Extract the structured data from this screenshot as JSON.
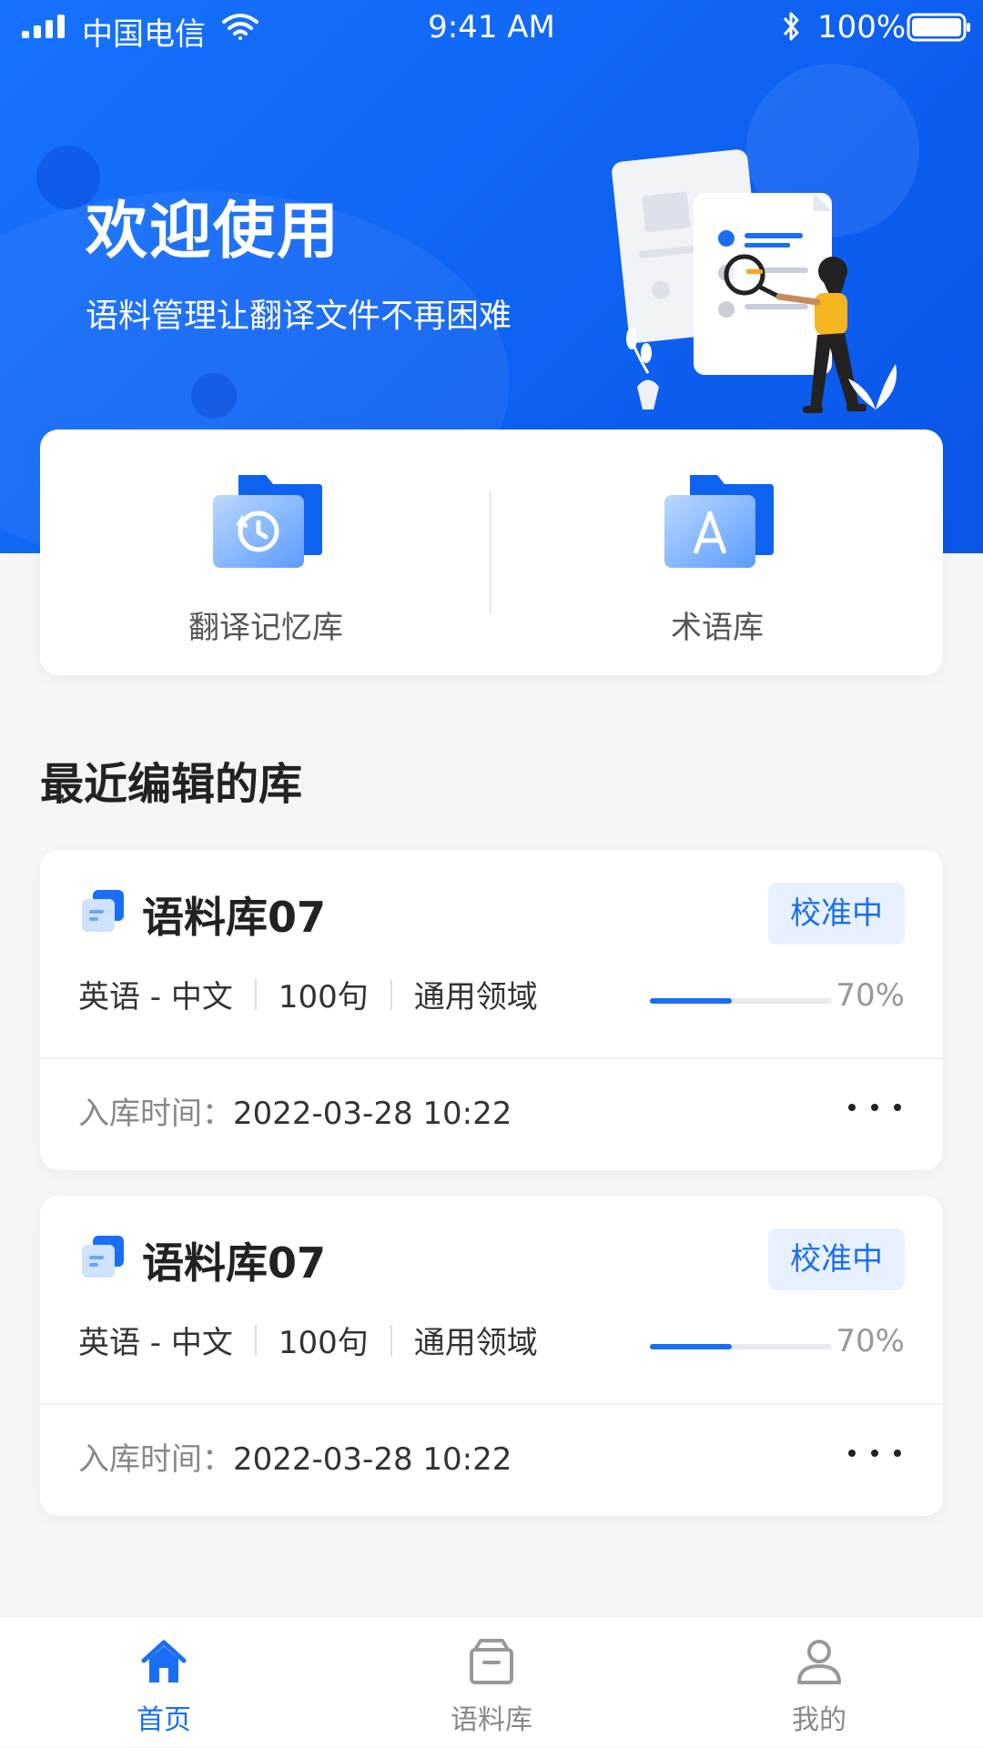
{
  "status_bar": {
    "carrier": "中国电信",
    "time": "9:41 AM",
    "battery": "100%"
  },
  "header": {
    "title": "欢迎使用",
    "subtitle": "语料管理让翻译文件不再困难"
  },
  "quick_entries": [
    {
      "label": "翻译记忆库",
      "icon": "history-folder-icon"
    },
    {
      "label": "术语库",
      "icon": "letter-a-folder-icon"
    }
  ],
  "section_title": "最近编辑的库",
  "libraries": [
    {
      "name": "语料库07",
      "status": "校准中",
      "language": "英语 - 中文",
      "sentences": "100句",
      "domain": "通用领域",
      "progress": 0.45,
      "progress_text": "70%",
      "date_label": "入库时间：",
      "date_value": "2022-03-28 10:22"
    },
    {
      "name": "语料库07",
      "status": "校准中",
      "language": "英语 - 中文",
      "sentences": "100句",
      "domain": "通用领域",
      "progress": 0.45,
      "progress_text": "70%",
      "date_label": "入库时间：",
      "date_value": "2022-03-28 10:22"
    }
  ],
  "tabbar": [
    {
      "label": "首页",
      "icon": "home-icon",
      "active": true
    },
    {
      "label": "语料库",
      "icon": "box-icon",
      "active": false
    },
    {
      "label": "我的",
      "icon": "user-icon",
      "active": false
    }
  ],
  "colors": {
    "primary": "#1a6ef5",
    "header_bg": "#0e62f2",
    "badge_bg": "#e8f1ff",
    "page_bg": "#f5f6f8"
  }
}
